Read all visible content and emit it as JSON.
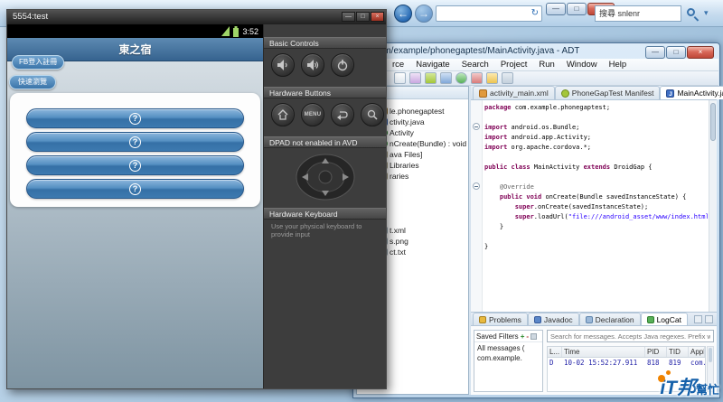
{
  "browser": {
    "search_text": "搜尋 snlenr",
    "nav": {
      "back": "←",
      "forward": "→",
      "refresh": "↻",
      "dropdown": "▾"
    }
  },
  "win_icons": {
    "min": "—",
    "max": "□",
    "close": "×"
  },
  "emulator": {
    "title": "5554:test",
    "phone": {
      "status_time": "3:52",
      "app_title": "東之宿",
      "fb_login_button": "FB登入註冊",
      "quick_view_button": "快速瀏覽",
      "action_buttons": [
        "?",
        "?",
        "?",
        "?"
      ]
    },
    "controls": {
      "basic_controls_header": "Basic Controls",
      "hardware_buttons_header": "Hardware Buttons",
      "menu_button": "MENU",
      "dpad_header": "DPAD not enabled in AVD",
      "keyboard_header": "Hardware Keyboard",
      "keyboard_description": "Use your physical keyboard to provide input"
    }
  },
  "eclipse": {
    "window_title": "/com/example/phonegaptest/MainActivity.java - ADT",
    "menu_items": [
      "rce",
      "Navigate",
      "Search",
      "Project",
      "Run",
      "Window",
      "Help"
    ],
    "explorer": {
      "items_top": [
        "le.phonegaptest",
        "ctivity.java",
        "Activity",
        "nCreate(Bundle) : void",
        "ava Files]",
        "Libraries",
        "raries"
      ],
      "items_bottom": [
        "t.xml",
        "s.png",
        "ct.txt"
      ]
    },
    "tabs": {
      "xml": "activity_main.xml",
      "manifest": "PhoneGapTest Manifest",
      "java": "MainActivity.java"
    },
    "icons": {
      "java_badge": "J",
      "close_tab": "×"
    },
    "code_lines": [
      [
        "package ",
        "com.example.phonegaptest;"
      ],
      [],
      [
        "import ",
        "android.os.Bundle;"
      ],
      [
        "import ",
        "android.app.Activity;"
      ],
      [
        "import ",
        "org.apache.cordova.*;"
      ],
      [],
      [
        "public class ",
        "MainActivity ",
        "extends ",
        "DroidGap {"
      ],
      [],
      [
        "    @Override"
      ],
      [
        "    public void ",
        "onCreate(Bundle savedInstanceState) {"
      ],
      [
        "        super",
        ".onCreate(savedInstanceState);"
      ],
      [
        "        super",
        ".loadUrl(",
        "\"file:///android_asset/www/index.html\"",
        ");"
      ],
      [
        "    }"
      ],
      [],
      [
        "}"
      ]
    ],
    "bottom_tabs": {
      "problems": "Problems",
      "javadoc": "Javadoc",
      "declaration": "Declaration",
      "logcat": "LogCat"
    },
    "logcat": {
      "saved_filters_header": "Saved Filters",
      "toolbar": {
        "add": "+",
        "remove": "-"
      },
      "filter_items": [
        "All messages (",
        "com.example."
      ],
      "search_placeholder": "Search for messages. Accepts Java regexes. Prefix with pid:, ap",
      "columns": [
        "L...",
        "Time",
        "PID",
        "TID",
        "Application"
      ],
      "row": {
        "level": "D",
        "time": "10-02 15:52:27.911",
        "pid": "818",
        "tid": "819",
        "application": "com.andro"
      }
    }
  },
  "watermark": {
    "text_main": "iT邦",
    "text_sub": "幫忙"
  }
}
